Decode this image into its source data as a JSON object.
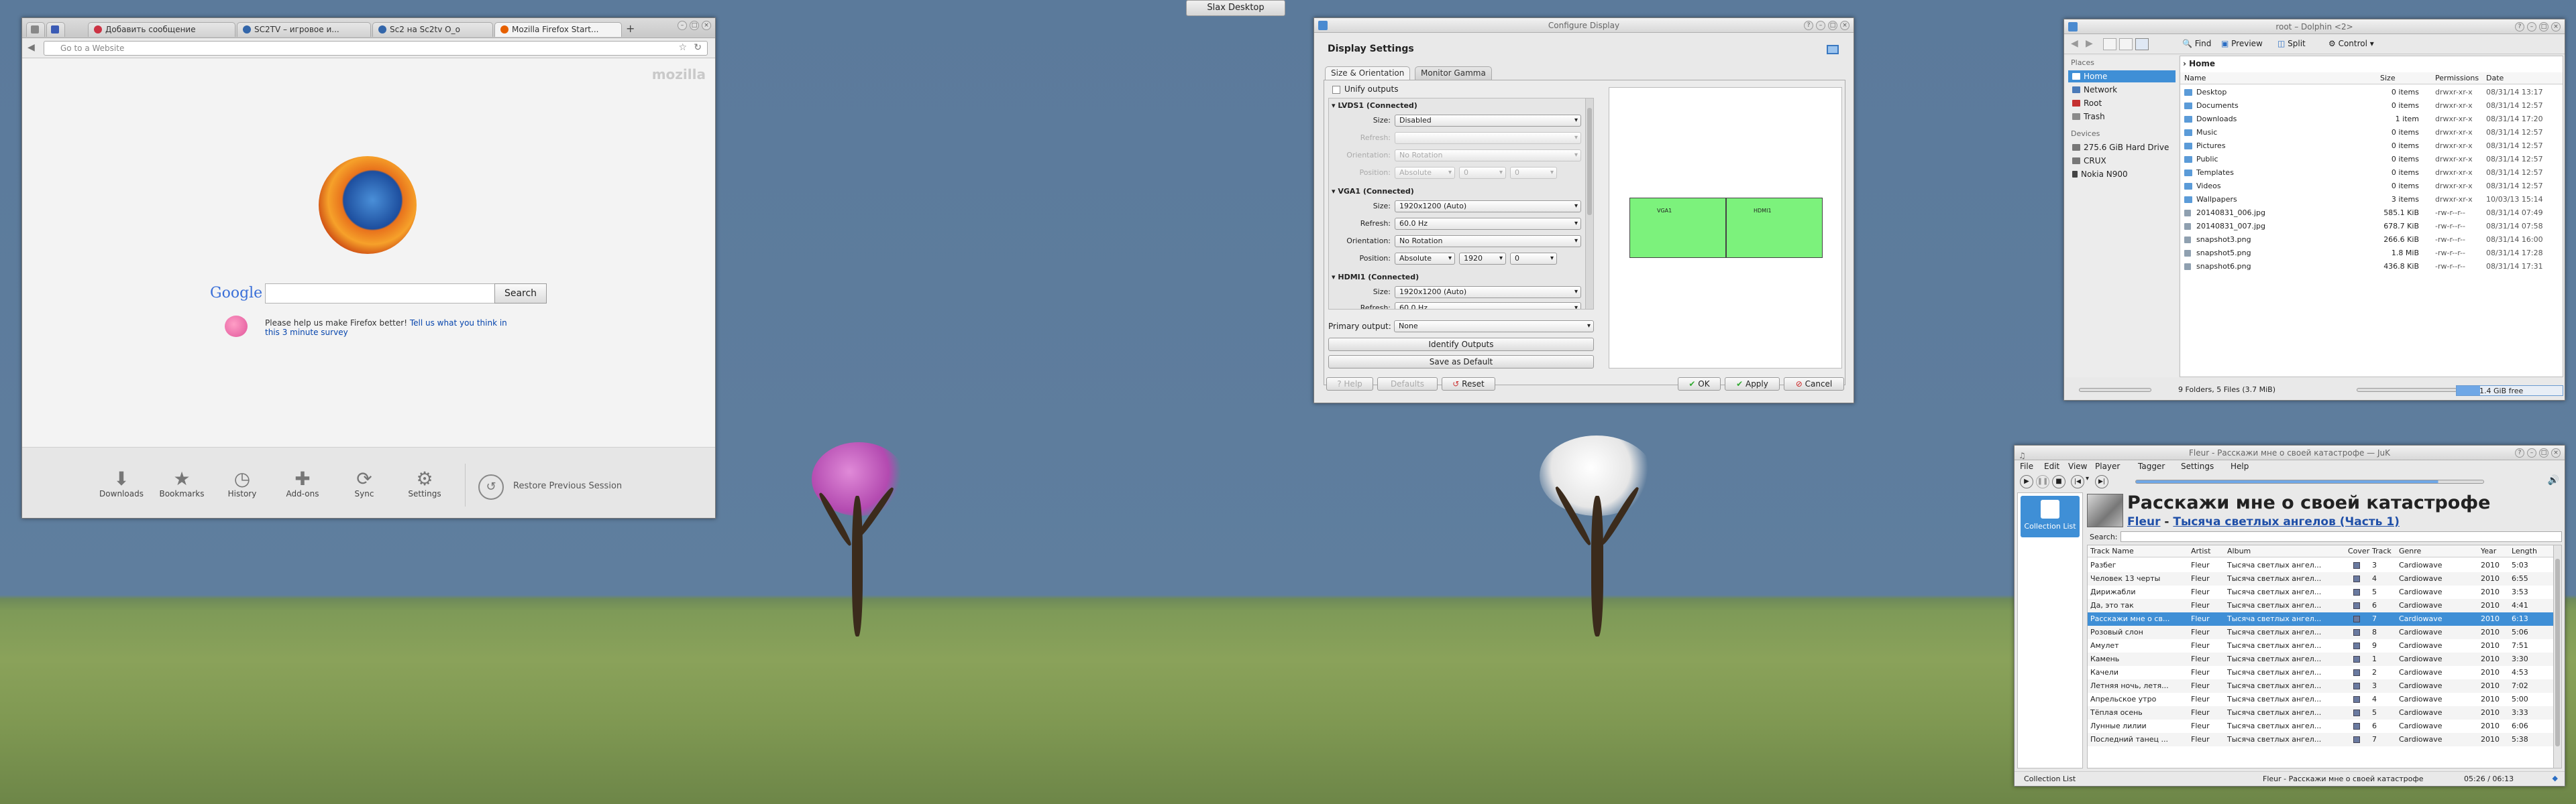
{
  "taskbar": {
    "slax_desktop": "Slax Desktop"
  },
  "firefox": {
    "tabs": [
      "Добавить сообщение",
      "SC2TV – игровое и...",
      "Sc2 на Sc2tv O_o",
      "Mozilla Firefox Start..."
    ],
    "url_placeholder": "Go to a Website",
    "brand": "mozilla",
    "google": "Google",
    "search_button": "Search",
    "survey_prefix": "Please help us make Firefox better!",
    "survey_link1": "Tell us what you think in",
    "survey_link2": "this 3 minute survey",
    "bottom": [
      "Downloads",
      "Bookmarks",
      "History",
      "Add-ons",
      "Sync",
      "Settings"
    ],
    "restore": "Restore Previous Session"
  },
  "display": {
    "window_title": "Configure Display",
    "heading": "Display Settings",
    "tabs": [
      "Size & Orientation",
      "Monitor Gamma"
    ],
    "unify": "Unify outputs",
    "outputs": [
      {
        "name": "LVDS1 (Connected)",
        "size": "Disabled",
        "refresh": "",
        "orientation": "No Rotation",
        "position": "Absolute",
        "x": "0",
        "y": "0"
      },
      {
        "name": "VGA1 (Connected)",
        "size": "1920x1200 (Auto)",
        "refresh": "60.0 Hz",
        "orientation": "No Rotation",
        "position": "Absolute",
        "x": "1920",
        "y": "0"
      },
      {
        "name": "HDMI1 (Connected)",
        "size": "1920x1200 (Auto)",
        "refresh": "60.0 Hz"
      }
    ],
    "labels": {
      "size": "Size:",
      "refresh": "Refresh:",
      "orientation": "Orientation:",
      "position": "Position:"
    },
    "primary_label": "Primary output:",
    "primary_value": "None",
    "identify": "Identify Outputs",
    "save_default": "Save as Default",
    "help": "Help",
    "defaults": "Defaults",
    "reset": "Reset",
    "ok": "OK",
    "apply": "Apply",
    "cancel": "Cancel",
    "preview_a": "VGA1",
    "preview_b": "HDMI1"
  },
  "dolphin": {
    "window_title": "root – Dolphin <2>",
    "toolbar": [
      "Find",
      "Preview",
      "Split",
      "Control"
    ],
    "places_heading": "Places",
    "places": [
      "Home",
      "Network",
      "Root",
      "Trash"
    ],
    "devices_heading": "Devices",
    "devices": [
      "275.6 GiB Hard Drive",
      "CRUX",
      "Nokia N900"
    ],
    "breadcrumb": "Home",
    "columns": [
      "Name",
      "Size",
      "Permissions",
      "Date"
    ],
    "files": [
      {
        "name": "Desktop",
        "size": "0 items",
        "perm": "drwxr-xr-x",
        "date": "08/31/14 13:17",
        "dir": true
      },
      {
        "name": "Documents",
        "size": "0 items",
        "perm": "drwxr-xr-x",
        "date": "08/31/14 12:57",
        "dir": true
      },
      {
        "name": "Downloads",
        "size": "1 item",
        "perm": "drwxr-xr-x",
        "date": "08/31/14 17:20",
        "dir": true
      },
      {
        "name": "Music",
        "size": "0 items",
        "perm": "drwxr-xr-x",
        "date": "08/31/14 12:57",
        "dir": true
      },
      {
        "name": "Pictures",
        "size": "0 items",
        "perm": "drwxr-xr-x",
        "date": "08/31/14 12:57",
        "dir": true
      },
      {
        "name": "Public",
        "size": "0 items",
        "perm": "drwxr-xr-x",
        "date": "08/31/14 12:57",
        "dir": true
      },
      {
        "name": "Templates",
        "size": "0 items",
        "perm": "drwxr-xr-x",
        "date": "08/31/14 12:57",
        "dir": true
      },
      {
        "name": "Videos",
        "size": "0 items",
        "perm": "drwxr-xr-x",
        "date": "08/31/14 12:57",
        "dir": true
      },
      {
        "name": "Wallpapers",
        "size": "3 items",
        "perm": "drwxr-xr-x",
        "date": "10/03/13 15:14",
        "dir": true
      },
      {
        "name": "20140831_006.jpg",
        "size": "585.1 KiB",
        "perm": "-rw-r--r--",
        "date": "08/31/14 07:49",
        "dir": false
      },
      {
        "name": "20140831_007.jpg",
        "size": "678.7 KiB",
        "perm": "-rw-r--r--",
        "date": "08/31/14 07:58",
        "dir": false
      },
      {
        "name": "snapshot3.png",
        "size": "266.6 KiB",
        "perm": "-rw-r--r--",
        "date": "08/31/14 16:00",
        "dir": false
      },
      {
        "name": "snapshot5.png",
        "size": "1.8 MiB",
        "perm": "-rw-r--r--",
        "date": "08/31/14 17:28",
        "dir": false
      },
      {
        "name": "snapshot6.png",
        "size": "436.8 KiB",
        "perm": "-rw-r--r--",
        "date": "08/31/14 17:31",
        "dir": false
      }
    ],
    "status": "9 Folders, 5 Files (3.7 MiB)",
    "free": "1.4 GiB free"
  },
  "juk": {
    "window_title": "Fleur - Расскажи мне о своей катастрофе — JuK",
    "menu": [
      "File",
      "Edit",
      "View",
      "Player",
      "Tagger",
      "Settings",
      "Help"
    ],
    "collection": "Collection List",
    "now_title": "Расскажи мне о своей катастрофе",
    "now_artist": "Fleur",
    "now_album": "Тысяча светлых ангелов (Часть 1)",
    "search_label": "Search:",
    "columns": [
      "Track Name",
      "Artist",
      "Album",
      "Cover",
      "Track",
      "Genre",
      "Year",
      "Length"
    ],
    "tracks": [
      {
        "name": "Разбег",
        "artist": "Fleur",
        "album": "Тысяча светлых ангел...",
        "track": "3",
        "genre": "Cardiowave",
        "year": "2010",
        "len": "5:03"
      },
      {
        "name": "Человек 13 черты",
        "artist": "Fleur",
        "album": "Тысяча светлых ангел...",
        "track": "4",
        "genre": "Cardiowave",
        "year": "2010",
        "len": "6:55"
      },
      {
        "name": "Дирижабли",
        "artist": "Fleur",
        "album": "Тысяча светлых ангел...",
        "track": "5",
        "genre": "Cardiowave",
        "year": "2010",
        "len": "3:53"
      },
      {
        "name": "Да, это так",
        "artist": "Fleur",
        "album": "Тысяча светлых ангел...",
        "track": "6",
        "genre": "Cardiowave",
        "year": "2010",
        "len": "4:41"
      },
      {
        "name": "Расскажи мне о св...",
        "artist": "Fleur",
        "album": "Тысяча светлых ангел...",
        "track": "7",
        "genre": "Cardiowave",
        "year": "2010",
        "len": "6:13",
        "selected": true
      },
      {
        "name": "Розовый слон",
        "artist": "Fleur",
        "album": "Тысяча светлых ангел...",
        "track": "8",
        "genre": "Cardiowave",
        "year": "2010",
        "len": "5:06"
      },
      {
        "name": "Амулет",
        "artist": "Fleur",
        "album": "Тысяча светлых ангел...",
        "track": "9",
        "genre": "Cardiowave",
        "year": "2010",
        "len": "7:51"
      },
      {
        "name": "Камень",
        "artist": "Fleur",
        "album": "Тысяча светлых ангел...",
        "track": "1",
        "genre": "Cardiowave",
        "year": "2010",
        "len": "3:30"
      },
      {
        "name": "Качели",
        "artist": "Fleur",
        "album": "Тысяча светлых ангел...",
        "track": "2",
        "genre": "Cardiowave",
        "year": "2010",
        "len": "4:53"
      },
      {
        "name": "Летняя ночь, летя...",
        "artist": "Fleur",
        "album": "Тысяча светлых ангел...",
        "track": "3",
        "genre": "Cardiowave",
        "year": "2010",
        "len": "7:02"
      },
      {
        "name": "Апрельское утро",
        "artist": "Fleur",
        "album": "Тысяча светлых ангел...",
        "track": "4",
        "genre": "Cardiowave",
        "year": "2010",
        "len": "5:00"
      },
      {
        "name": "Тёплая осень",
        "artist": "Fleur",
        "album": "Тысяча светлых ангел...",
        "track": "5",
        "genre": "Cardiowave",
        "year": "2010",
        "len": "3:33"
      },
      {
        "name": "Лунные лилии",
        "artist": "Fleur",
        "album": "Тысяча светлых ангел...",
        "track": "6",
        "genre": "Cardiowave",
        "year": "2010",
        "len": "6:06"
      },
      {
        "name": "Последний танец ...",
        "artist": "Fleur",
        "album": "Тысяча светлых ангел...",
        "track": "7",
        "genre": "Cardiowave",
        "year": "2010",
        "len": "5:38"
      }
    ],
    "status_left": "Collection List",
    "status_right": "Fleur - Расскажи мне о своей катастрофе",
    "time": "05:26 / 06:13"
  }
}
